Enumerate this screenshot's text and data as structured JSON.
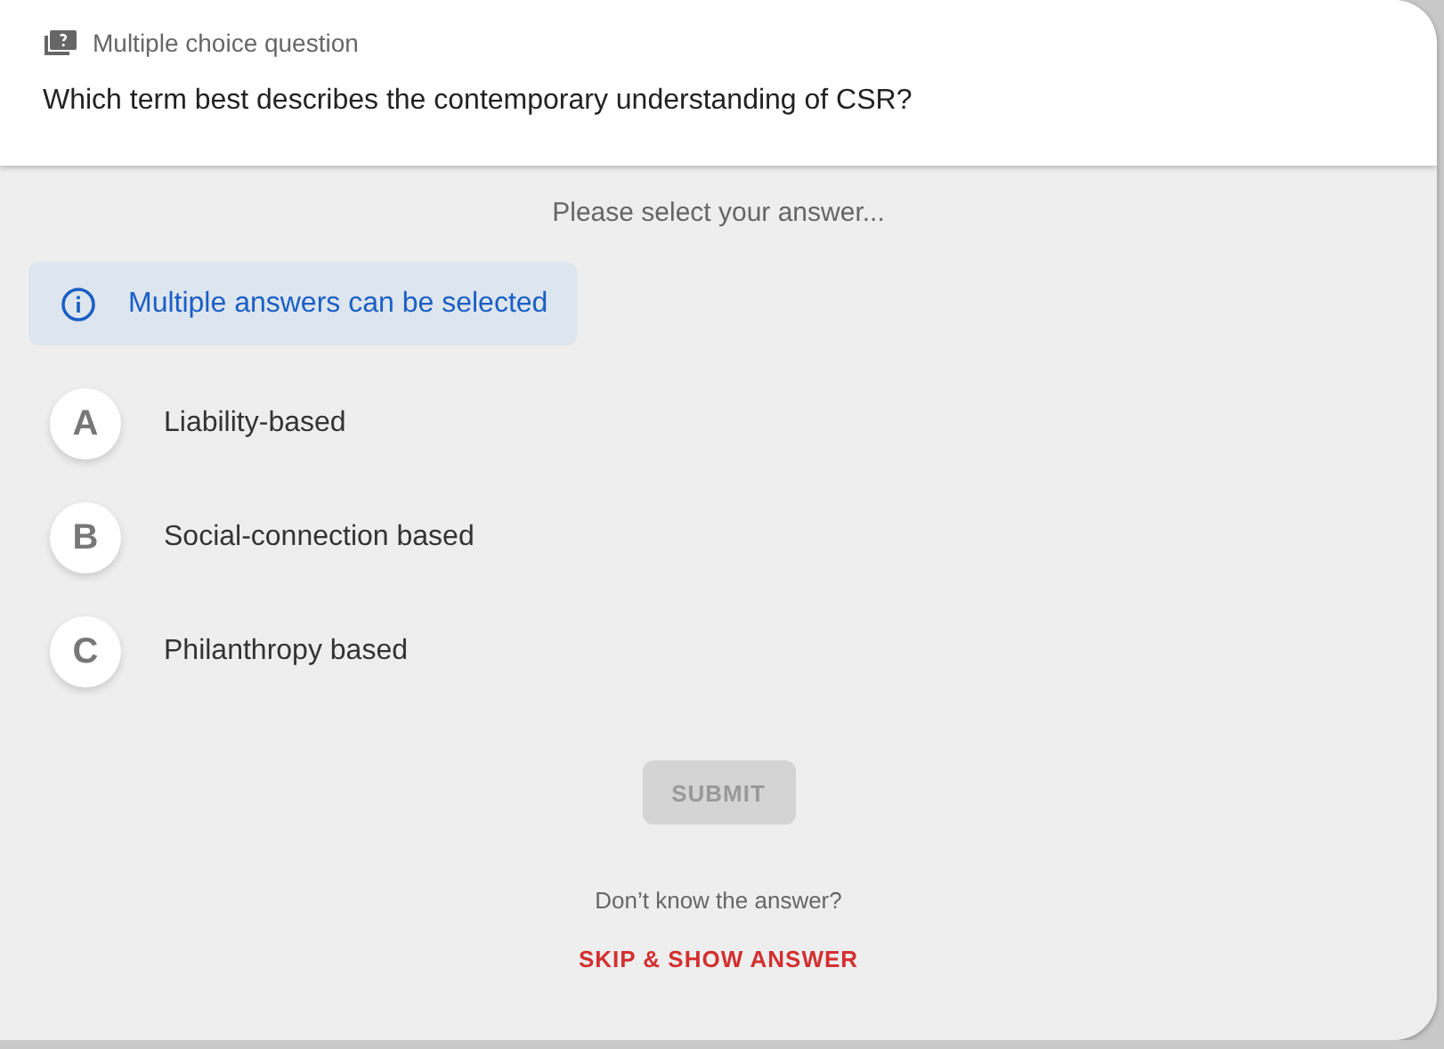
{
  "header": {
    "type_label": "Multiple choice question",
    "question": "Which term best describes the contemporary understanding of CSR?"
  },
  "prompt": "Please select your answer...",
  "info": "Multiple answers can be selected",
  "options": [
    {
      "letter": "A",
      "text": "Liability-based",
      "selected": false
    },
    {
      "letter": "B",
      "text": "Social-connection based",
      "selected": false
    },
    {
      "letter": "C",
      "text": "Philanthropy based",
      "selected": false
    }
  ],
  "submit": {
    "label": "SUBMIT",
    "disabled": true
  },
  "skip_prompt": "Don’t know the answer?",
  "skip_link": "SKIP & SHOW ANSWER"
}
